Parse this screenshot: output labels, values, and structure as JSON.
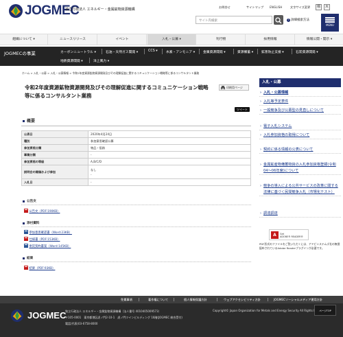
{
  "header": {
    "logo_text": "JOGMEC",
    "logo_sub": "独立行政法人 エネルギー・金属鉱物資源機構",
    "links": [
      "お問合せ",
      "サイトマップ",
      "ENGLISH",
      "文字サイズ変更"
    ],
    "font_sizes": [
      "標",
      "大"
    ],
    "search_placeholder": "サイト内検索",
    "advanced_search": "詳細検索方法",
    "menu_label": "MENU"
  },
  "gnav": [
    {
      "label": "組織について ▾",
      "active": false
    },
    {
      "label": "ニュースリリース",
      "active": false
    },
    {
      "label": "イベント",
      "active": false
    },
    {
      "label": "入札・公募 ▾",
      "active": true
    },
    {
      "label": "刊行物",
      "active": false
    },
    {
      "label": "採用情報",
      "active": false
    },
    {
      "label": "情報公開・開示 ▾",
      "active": false
    }
  ],
  "subnav": {
    "title": "JOGMECの事業",
    "row1": [
      "カーボンニュートラル ▾",
      "石油・天然ガス開発 ▾",
      "CCS ▾",
      "水素・アンモニア ▾",
      "金属資源開発 ▾",
      "資源備蓄 ▾",
      "鉱害防止支援 ▾",
      "石炭資源開発 ▾"
    ],
    "row2": [
      "地熱資源開発 ▾",
      "洋上風力 ▾"
    ]
  },
  "breadcrumb": "ホーム > 入札・公募 > 入札・公募情報 > 令和2年度資源鉱物資源開発及びその理解促進に関するコミュニケーション戦略等に係るコンサルタント業務",
  "page": {
    "title": "令和2年度資源鉱物資源開発及びその理解促進に関するコミュニケーション戦略等に係るコンサルタント業務",
    "print_label": "印刷用ページ",
    "tweet_label": "ツイート",
    "overview_heading": "概要",
    "table": [
      {
        "key": "公表日",
        "value": "2020年4月24日"
      },
      {
        "key": "種別",
        "value": "参加意思確認公募"
      },
      {
        "key": "参加資格分類",
        "value": "物品・役務"
      },
      {
        "key": "事業分類",
        "value": "-"
      },
      {
        "key": "参加資格の等級",
        "value": "A,B/C/D"
      },
      {
        "key": "説明会の開催および参加",
        "value": "なし\n-"
      },
      {
        "key": "入札日",
        "value": "-"
      }
    ],
    "public_notice_heading": "公告文",
    "public_notice_files": [
      "公告文（PDF:190KB）"
    ],
    "attachments_heading": "添付資料",
    "attachment_files": [
      "参加意思確認書（Word:23KB）",
      "仕様書（PDF:153KB）",
      "委託契約書案（Word:145KB）"
    ],
    "result_heading": "結果",
    "result_files": [
      "結果（PDF:93KB）"
    ]
  },
  "side": {
    "heading": "入札・公募",
    "items": [
      "入札・公募情報",
      "入札等予定表件",
      "一般競争及び公募型の見直しについて",
      "電子入札システム",
      "入札参加資格の取得について",
      "契約に係る情報の公表について",
      "金属鉱産物備蓄物資の入札参加資格登録(令和04〜06年度)について",
      "競争の導入による公共サービスの改革に関する法律に基づく民間競争入札（市場化テスト）",
      "調達調達"
    ],
    "adobe_text_1": "Get",
    "adobe_text_2": "ADOBE® READER®",
    "pdf_note": "PDF形式のファイルをご覧いただくには、アドビシステムズ社の無償配布されているAdobe Readerプラグインが必要です。"
  },
  "footer": {
    "links": [
      "免責事項",
      "著作権について",
      "個人情報保護方針",
      "ウェブアクセシビリティ方針",
      "JOGMECソーシャルメディア運用方針"
    ],
    "logo_text": "JOGMEC",
    "org": "独立行政法人 エネルギー・金属鉱物資源機構（法人番号 4010405009573）",
    "address": "〒105-0001　東京都港区虎ノ門2-10-1　虎ノ門ツインビルディング 16階(JOGMEC 総合受付)",
    "tel": "電話(代表)03-6758-8000",
    "copyright": "Copyright© Japan Organization for Metals and Energy Security All Rights Reserved.",
    "pagetop": "ページTOP"
  },
  "colors": {
    "brand": "#1f2e6e",
    "link": "#1a3a8c",
    "dark_bar": "#242424"
  }
}
